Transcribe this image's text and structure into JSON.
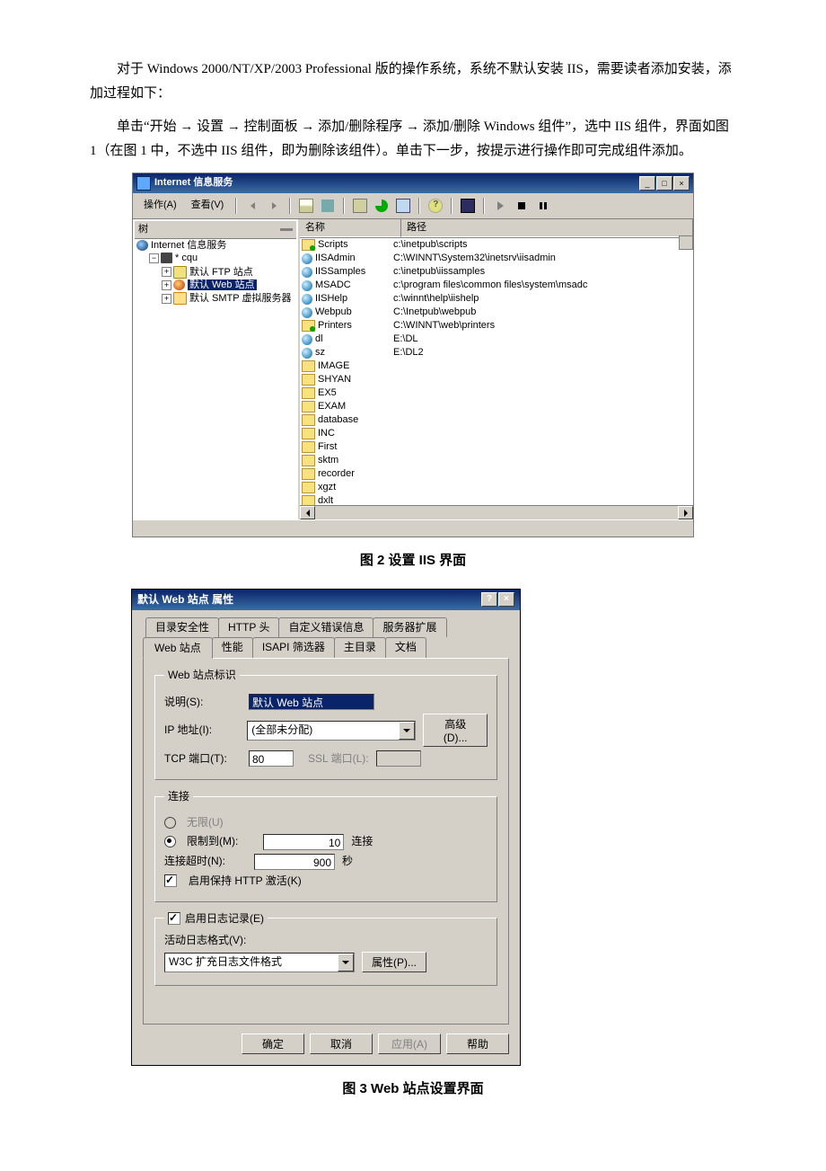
{
  "intro": {
    "p1": "对于 Windows 2000/NT/XP/2003 Professional 版的操作系统，系统不默认安装 IIS，需要读者添加安装，添加过程如下：",
    "p2": "单击“开始 → 设置 → 控制面板 → 添加/删除程序 → 添加/删除 Windows 组件”，选中 IIS 组件，界面如图 1（在图 1 中，不选中 IIS 组件，即为删除该组件）。单击下一步，按提示进行操作即可完成组件添加。"
  },
  "fig2": {
    "window_title": "Internet 信息服务",
    "menu": {
      "action": "操作(A)",
      "view": "查看(V)"
    },
    "tree_header": "树",
    "tree": {
      "root": "Internet 信息服务",
      "server": "* cqu",
      "ftp": "默认 FTP 站点",
      "web": "默认 Web 站点",
      "smtp": "默认 SMTP 虚拟服务器"
    },
    "cols": {
      "name": "名称",
      "path": "路径"
    },
    "rows": [
      {
        "icon": "foldg",
        "name": "Scripts",
        "path": "c:\\inetpub\\scripts"
      },
      {
        "icon": "globe",
        "name": "IISAdmin",
        "path": "C:\\WINNT\\System32\\inetsrv\\iisadmin"
      },
      {
        "icon": "globe",
        "name": "IISSamples",
        "path": "c:\\inetpub\\iissamples"
      },
      {
        "icon": "globe",
        "name": "MSADC",
        "path": "c:\\program files\\common files\\system\\msadc"
      },
      {
        "icon": "globe",
        "name": "IISHelp",
        "path": "c:\\winnt\\help\\iishelp"
      },
      {
        "icon": "globe",
        "name": "Webpub",
        "path": "C:\\Inetpub\\webpub"
      },
      {
        "icon": "foldg",
        "name": "Printers",
        "path": "C:\\WINNT\\web\\printers"
      },
      {
        "icon": "globe",
        "name": "dl",
        "path": "E:\\DL"
      },
      {
        "icon": "globe",
        "name": "sz",
        "path": "E:\\DL2"
      },
      {
        "icon": "fold",
        "name": "IMAGE",
        "path": ""
      },
      {
        "icon": "fold",
        "name": "SHYAN",
        "path": ""
      },
      {
        "icon": "fold",
        "name": "EX5",
        "path": ""
      },
      {
        "icon": "fold",
        "name": "EXAM",
        "path": ""
      },
      {
        "icon": "fold",
        "name": "database",
        "path": ""
      },
      {
        "icon": "fold",
        "name": "INC",
        "path": ""
      },
      {
        "icon": "fold",
        "name": "First",
        "path": ""
      },
      {
        "icon": "fold",
        "name": "sktm",
        "path": ""
      },
      {
        "icon": "fold",
        "name": "recorder",
        "path": ""
      },
      {
        "icon": "fold",
        "name": "xgzt",
        "path": ""
      },
      {
        "icon": "fold",
        "name": "dxlt",
        "path": ""
      }
    ],
    "caption": "图 2 设置 IIS 界面"
  },
  "fig3": {
    "title": "默认 Web 站点 属性",
    "tabs_back": [
      "目录安全性",
      "HTTP 头",
      "自定义错误信息",
      "服务器扩展"
    ],
    "tabs_front": [
      "Web 站点",
      "性能",
      "ISAPI 筛选器",
      "主目录",
      "文档"
    ],
    "ident": {
      "legend": "Web 站点标识",
      "desc_lbl": "说明(S):",
      "desc_val": "默认 Web 站点",
      "ip_lbl": "IP 地址(I):",
      "ip_val": "(全部未分配)",
      "adv_btn": "高级(D)...",
      "tcp_lbl": "TCP 端口(T):",
      "tcp_val": "80",
      "ssl_lbl": "SSL 端口(L):"
    },
    "conn": {
      "legend": "连接",
      "unlimited": "无限(U)",
      "limited": "限制到(M):",
      "limited_val": "10",
      "limited_suffix": "连接",
      "timeout": "连接超时(N):",
      "timeout_val": "900",
      "timeout_suffix": "秒",
      "keepalive": "启用保持 HTTP 激活(K)"
    },
    "log": {
      "enable": "启用日志记录(E)",
      "format_lbl": "活动日志格式(V):",
      "format_val": "W3C 扩充日志文件格式",
      "prop_btn": "属性(P)..."
    },
    "btns": {
      "ok": "确定",
      "cancel": "取消",
      "apply": "应用(A)",
      "help": "帮助"
    },
    "caption": "图 3  Web 站点设置界面"
  }
}
